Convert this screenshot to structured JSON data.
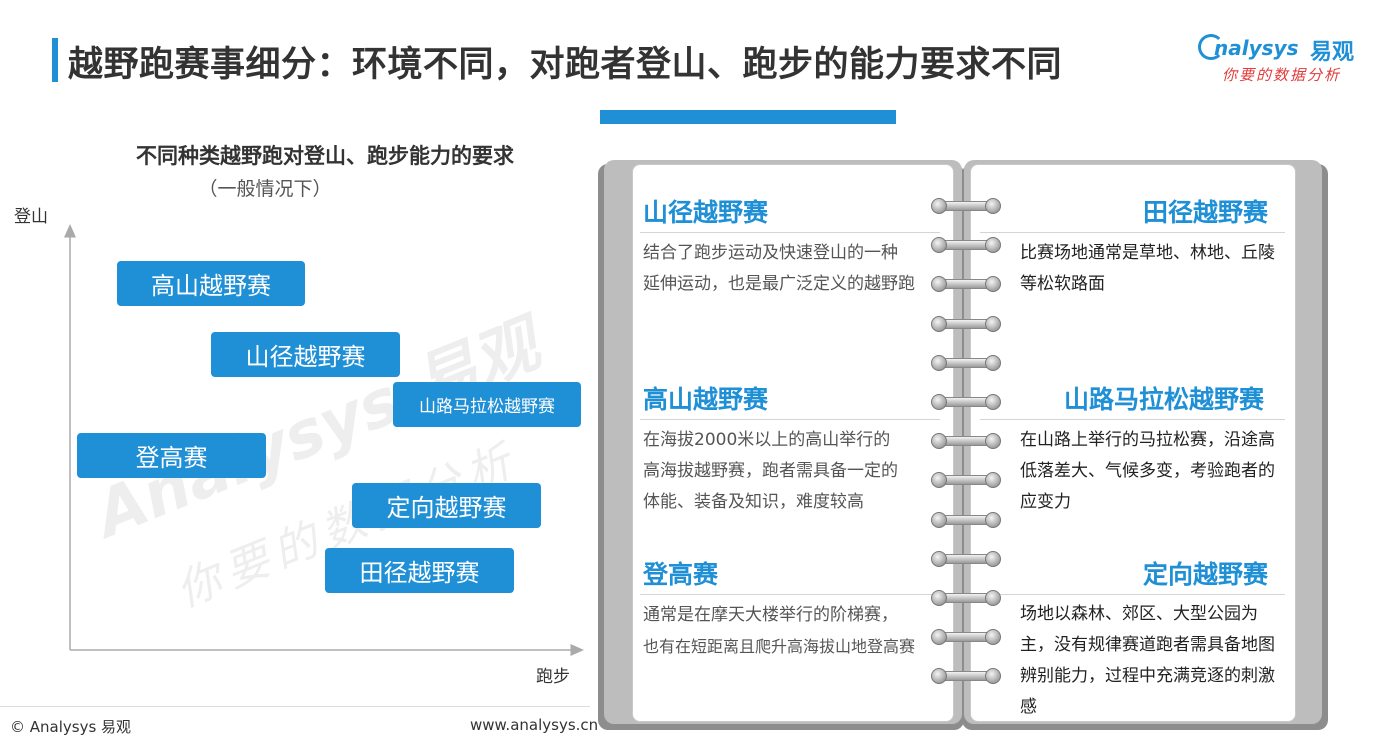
{
  "header": {
    "title": "越野跑赛事细分：环境不同，对跑者登山、跑步的能力要求不同"
  },
  "logo": {
    "name_en": "nalysys",
    "name_cn": "易观",
    "slogan": "你要的数据分析"
  },
  "chart": {
    "title": "不同种类越野跑对登山、跑步能力的要求",
    "subtitle": "（一般情况下）",
    "y_axis_label": "登山",
    "x_axis_label": "跑步",
    "boxes": [
      {
        "label": "高山越野赛"
      },
      {
        "label": "山径越野赛"
      },
      {
        "label": "山路马拉松越野赛"
      },
      {
        "label": "登高赛"
      },
      {
        "label": "定向越野赛"
      },
      {
        "label": "田径越野赛"
      }
    ]
  },
  "chart_data": {
    "type": "scatter",
    "xlabel": "跑步",
    "ylabel": "登山",
    "points": [
      {
        "label": "高山越野赛",
        "x": 0.28,
        "y": 0.86
      },
      {
        "label": "山径越野赛",
        "x": 0.45,
        "y": 0.68
      },
      {
        "label": "山路马拉松越野赛",
        "x": 0.85,
        "y": 0.56
      },
      {
        "label": "登高赛",
        "x": 0.22,
        "y": 0.43
      },
      {
        "label": "定向越野赛",
        "x": 0.72,
        "y": 0.3
      },
      {
        "label": "田径越野赛",
        "x": 0.68,
        "y": 0.13
      }
    ]
  },
  "notebook": {
    "left": [
      {
        "heading": "山径越野赛",
        "lines": [
          "结合了跑步运动及快速登山的一种",
          "延伸运动，也是最广泛定义的越野跑"
        ]
      },
      {
        "heading": "高山越野赛",
        "lines": [
          "在海拔2000米以上的高山举行的",
          "高海拔越野赛，跑者需具备一定的",
          "体能、装备及知识，难度较高"
        ]
      },
      {
        "heading": "登高赛",
        "lines": [
          "通常是在摩天大楼举行的阶梯赛，",
          "也有在短距离且爬升高海拔山地登高赛"
        ]
      }
    ],
    "right": [
      {
        "heading": "田径越野赛",
        "lines": [
          "比赛场地通常是草地、林地、丘陵",
          "等松软路面"
        ]
      },
      {
        "heading": "山路马拉松越野赛",
        "lines": [
          "在山路上举行的马拉松赛，沿途高",
          "低落差大、气候多变，考验跑者的",
          "应变力"
        ]
      },
      {
        "heading": "定向越野赛",
        "lines": [
          "场地以森林、郊区、大型公园为",
          "主，没有规律赛道跑者需具备地图",
          "辨别能力，过程中充满竞逐的刺激",
          "感"
        ]
      }
    ]
  },
  "footer": {
    "copyright": "© Analysys 易观",
    "url": "www.analysys.cn"
  },
  "colors": {
    "accent": "#1f8fd6",
    "slogan": "#e23c3c"
  }
}
